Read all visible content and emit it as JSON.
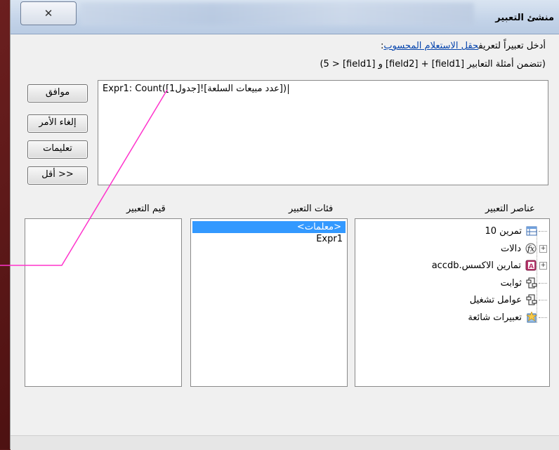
{
  "dialog": {
    "title": "منشئ التعبير",
    "close_glyph": "✕"
  },
  "prompt": {
    "text_before": "أدخل تعبيراً لتعريف",
    "link": "حقل الاستعلام المحسوب",
    "text_after": ":",
    "example": "(تتضمن أمثلة التعابير [field1] + [field2] و [field1] < 5)"
  },
  "buttons": {
    "ok": "موافق",
    "cancel": "إلغاء الأمر",
    "help": "تعليمات",
    "less": "<< أقل"
  },
  "expression": {
    "value": "Expr1: Count([جدول1]![عدد مبيعات السلعة])"
  },
  "panels": {
    "values_label": "قيم التعبير",
    "categories_label": "فئات التعبير",
    "elements_label": "عناصر التعبير"
  },
  "categories": [
    "<معلمات>",
    "Expr1"
  ],
  "elements": [
    {
      "label": "تمرين 10",
      "icon": "query-icon",
      "expander": ""
    },
    {
      "label": "دالات",
      "icon": "function-icon",
      "expander": "+"
    },
    {
      "label": "تمارين الاكسس.accdb",
      "icon": "database-icon",
      "expander": "+"
    },
    {
      "label": "ثوابت",
      "icon": "folder-icon",
      "expander": ""
    },
    {
      "label": "عوامل تشغيل",
      "icon": "folder-icon",
      "expander": ""
    },
    {
      "label": "تعبيرات شائعة",
      "icon": "common-expression-icon",
      "expander": ""
    }
  ],
  "colors": {
    "selection": "#3399ff",
    "pointer_line": "#ff33cc"
  }
}
